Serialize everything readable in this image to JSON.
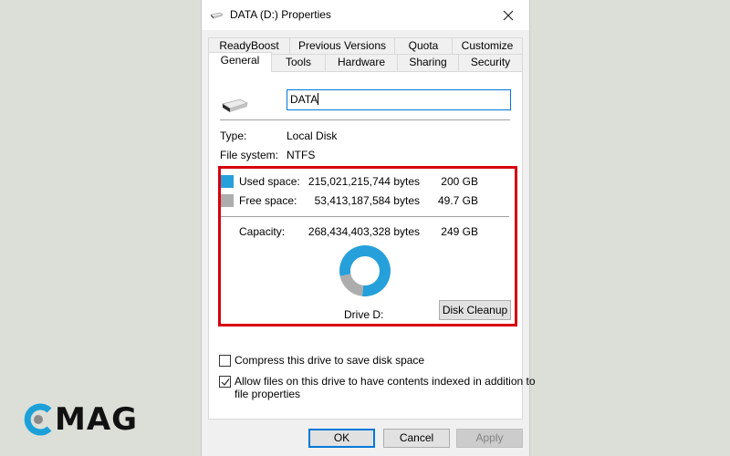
{
  "window": {
    "title": "DATA (D:) Properties",
    "close_label": "✕"
  },
  "tabs": {
    "row1": [
      {
        "label": "ReadyBoost"
      },
      {
        "label": "Previous Versions"
      },
      {
        "label": "Quota"
      },
      {
        "label": "Customize"
      }
    ],
    "row2": [
      {
        "label": "General",
        "active": true
      },
      {
        "label": "Tools"
      },
      {
        "label": "Hardware"
      },
      {
        "label": "Sharing"
      },
      {
        "label": "Security"
      }
    ]
  },
  "general": {
    "name_value": "DATA",
    "type_label": "Type:",
    "type_value": "Local Disk",
    "fs_label": "File system:",
    "fs_value": "NTFS",
    "used": {
      "label": "Used space:",
      "bytes": "215,021,215,744 bytes",
      "size": "200 GB",
      "color": "#26a0da"
    },
    "free": {
      "label": "Free space:",
      "bytes": "53,413,187,584 bytes",
      "size": "49.7 GB",
      "color": "#adadad"
    },
    "capacity": {
      "label": "Capacity:",
      "bytes": "268,434,403,328 bytes",
      "size": "249 GB"
    },
    "used_fraction": 0.801,
    "drive_label": "Drive D:",
    "cleanup_label": "Disk Cleanup",
    "compress": {
      "label": "Compress this drive to save disk space",
      "checked": false
    },
    "index": {
      "label": "Allow files on this drive to have contents indexed in addition to",
      "label2": "file properties",
      "checked": true
    }
  },
  "buttons": {
    "ok": "OK",
    "cancel": "Cancel",
    "apply": "Apply"
  },
  "watermark": {
    "text": "MAG",
    "accent": "#1ba0d8"
  }
}
